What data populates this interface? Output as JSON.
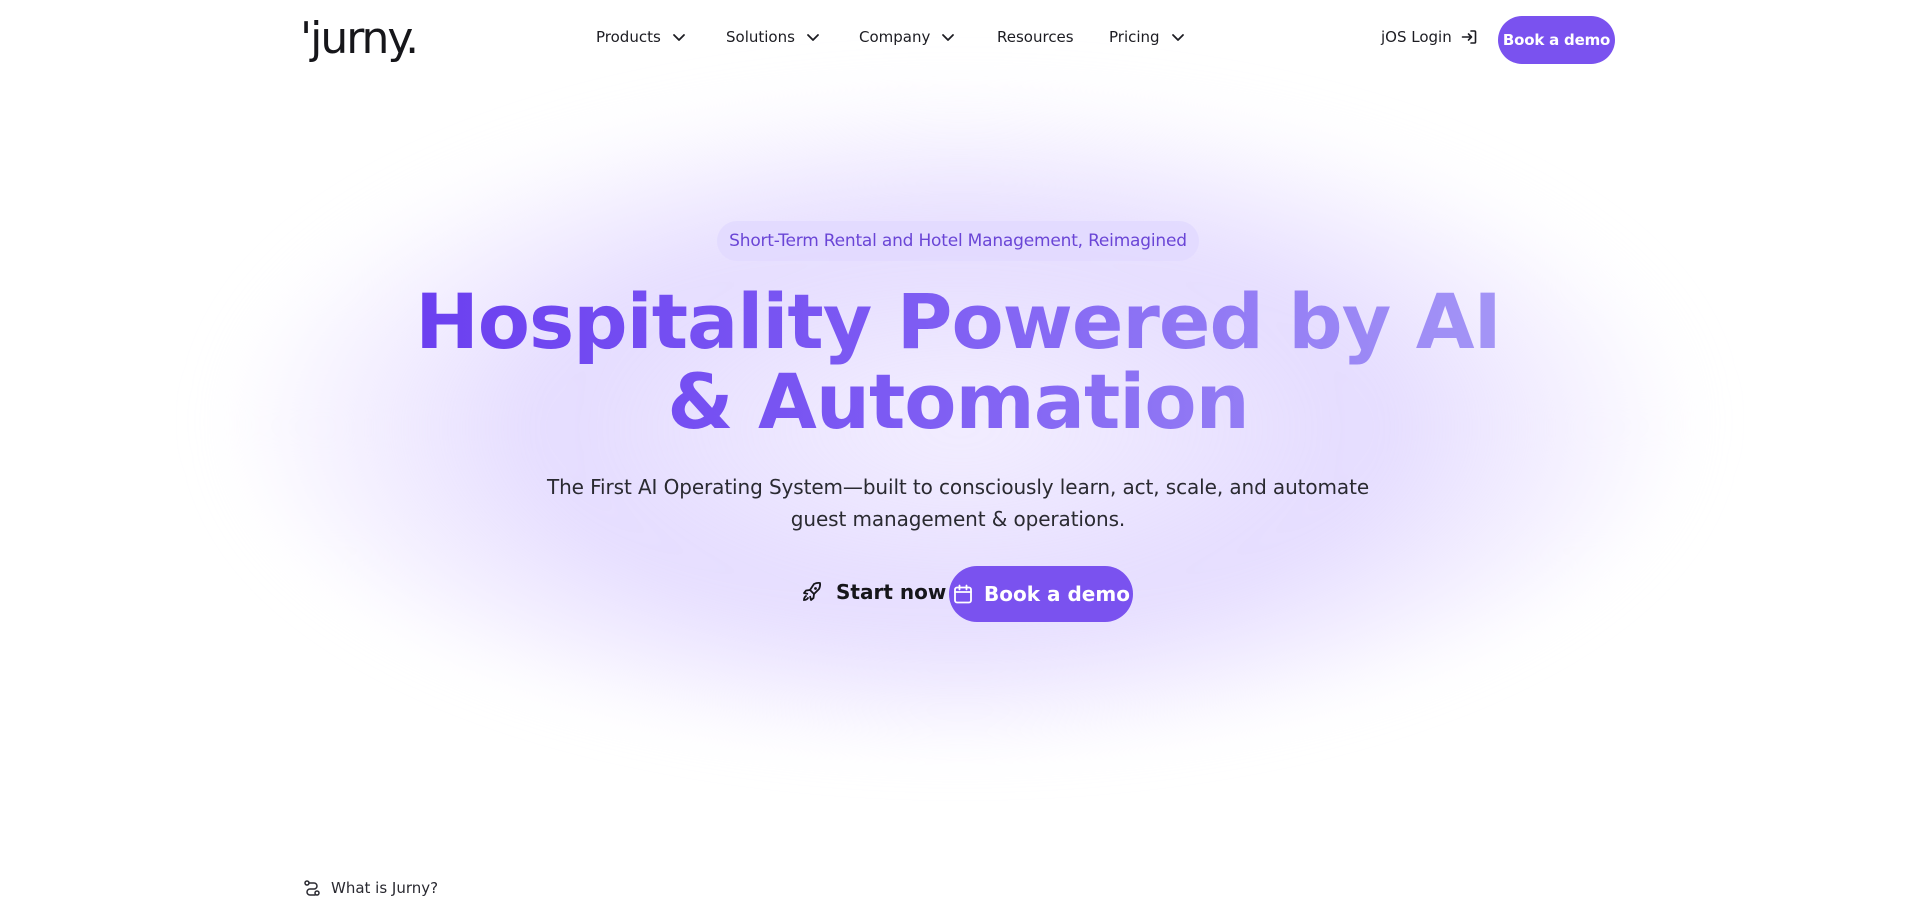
{
  "brand": {
    "logo_text": "'jurny."
  },
  "nav": {
    "items": [
      {
        "label": "Products",
        "has_dropdown": true
      },
      {
        "label": "Solutions",
        "has_dropdown": true
      },
      {
        "label": "Company",
        "has_dropdown": true
      },
      {
        "label": "Resources",
        "has_dropdown": false
      },
      {
        "label": "Pricing",
        "has_dropdown": true
      }
    ],
    "login_label": "jOS Login",
    "demo_label": "Book a demo"
  },
  "hero": {
    "badge": "Short-Term Rental and Hotel Management, Reimagined",
    "headline_line1": "Hospitality Powered by AI",
    "headline_line2": "& Automation",
    "subtitle": "The First AI Operating System—built to consciously learn, act, scale, and automate guest management & operations.",
    "start_label": "Start now",
    "demo_label": "Book a demo"
  },
  "footer_link": {
    "label": "What is Jurny?"
  },
  "colors": {
    "accent": "#7a52ef",
    "badge_bg": "#e2d9ff",
    "badge_text": "#6a45d6",
    "text": "#1c1c22"
  },
  "icons": {
    "dropdown": "chevron-down-icon",
    "login": "login-arrow-icon",
    "start": "rocket-icon",
    "demo": "calendar-icon",
    "what": "route-icon"
  }
}
